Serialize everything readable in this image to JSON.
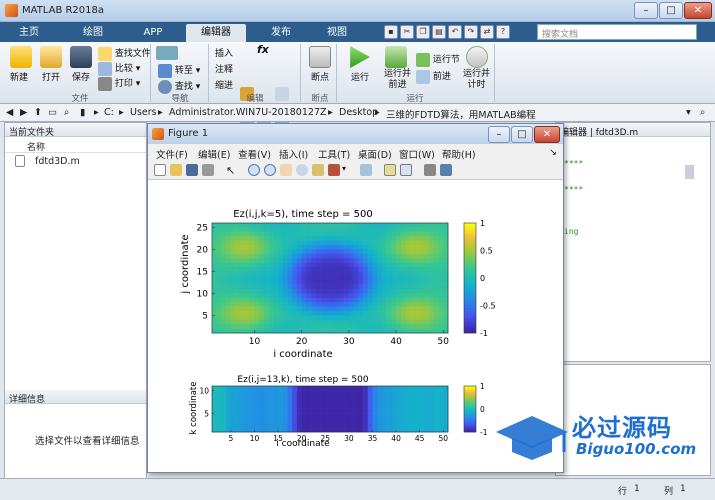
{
  "app": {
    "title": "MATLAB R2018a"
  },
  "ribbon_tabs": [
    "主页",
    "绘图",
    "APP",
    "编辑器",
    "发布",
    "视图"
  ],
  "search": {
    "placeholder": "搜索文档"
  },
  "ribbon": {
    "new": "新建",
    "open": "打开",
    "save": "保存",
    "find_files": "查找文件",
    "compare": "比较",
    "print": "打印",
    "goto": "转至",
    "find": "查找",
    "insert": "插入",
    "comment": "注释",
    "indent": "缩进",
    "breakpoints": "断点",
    "run": "运行",
    "run_advance": [
      "运行并",
      "前进"
    ],
    "run_section": "运行节",
    "advance": "前进",
    "run_time": [
      "运行并",
      "计时"
    ],
    "groups": {
      "file": "文件",
      "navigate": "导航",
      "edit": "编辑",
      "breakpoints": "断点",
      "run": "运行"
    }
  },
  "address": {
    "crumbs": [
      "C:",
      "Users",
      "Administrator.WIN7U-20180127Z",
      "Desktop",
      "三维的FDTD算法，用MATLAB编程"
    ]
  },
  "current_folder": {
    "title": "当前文件夹",
    "column": "名称",
    "files": [
      "fdtd3D.m"
    ],
    "details_title": "详细信息",
    "details_hint": "选择文件以查看详细信息"
  },
  "editor": {
    "tab": "编辑器 | fdtd3D.m",
    "snippets": [
      "****",
      "****",
      "ing"
    ]
  },
  "status": {
    "row_label": "行",
    "row": "1",
    "col_label": "列",
    "col": "1"
  },
  "figure": {
    "title": "Figure 1",
    "menus": [
      "文件(F)",
      "编辑(E)",
      "查看(V)",
      "插入(I)",
      "工具(T)",
      "桌面(D)",
      "窗口(W)",
      "帮助(H)"
    ]
  },
  "colors": {
    "tabstrip": "#2d5d8c",
    "accent": "#f8a33a"
  },
  "watermark": {
    "title": "必过源码",
    "site": "Biguo100.com"
  },
  "chart_data": [
    {
      "type": "heatmap",
      "title": "Ez(i,j,k=5), time step = 500",
      "xlabel": "i coordinate",
      "ylabel": "j coordinate",
      "xlim": [
        1,
        51
      ],
      "ylim": [
        1,
        26
      ],
      "xticks": [
        10,
        20,
        30,
        40,
        50
      ],
      "yticks": [
        5,
        10,
        15,
        20,
        25
      ],
      "colorbar": {
        "range": [
          -1,
          1
        ],
        "ticks": [
          "1",
          "0.5",
          "0",
          "-0.5",
          "-1"
        ]
      },
      "colormap": "parula",
      "description_values": {
        "center_min": -1,
        "corner_max": 0.5
      }
    },
    {
      "type": "heatmap",
      "title": "Ez(i,j=13,k), time step = 500",
      "xlabel": "i coordinate",
      "ylabel": "k coordinate",
      "xlim": [
        1,
        51
      ],
      "ylim": [
        1,
        11
      ],
      "xticks": [
        5,
        10,
        15,
        20,
        25,
        30,
        35,
        40,
        45,
        50
      ],
      "yticks": [
        5,
        10
      ],
      "colorbar": {
        "range": [
          -1,
          1
        ],
        "ticks": [
          "1",
          "0",
          "-1"
        ]
      },
      "colormap": "parula"
    }
  ]
}
